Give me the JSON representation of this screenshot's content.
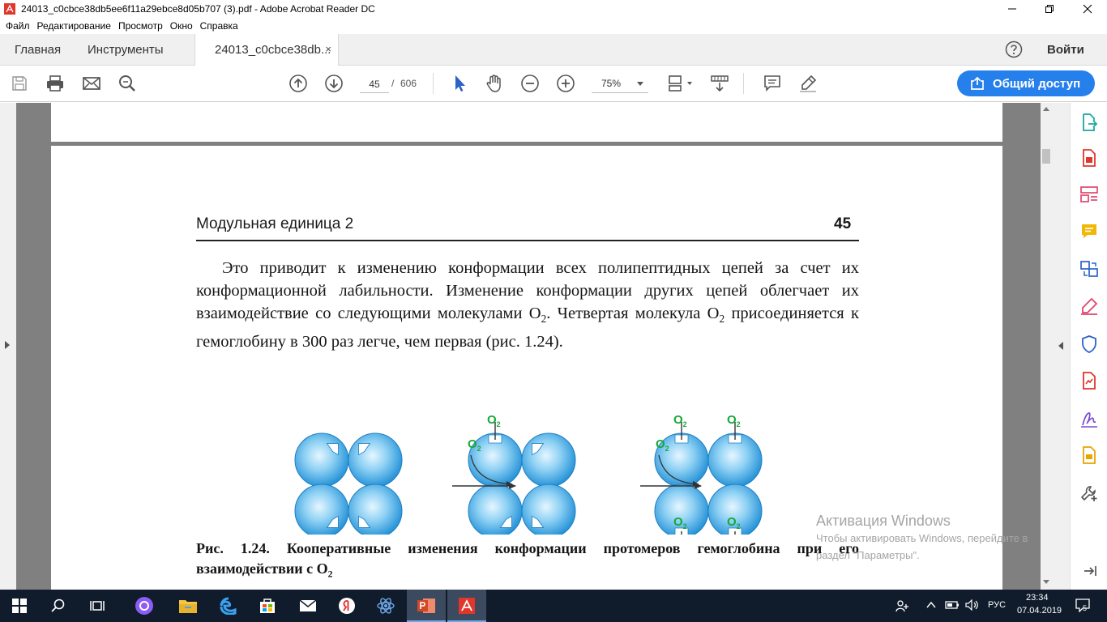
{
  "window": {
    "title": "24013_c0cbce38db5ee6f11a29ebce8d05b707 (3).pdf - Adobe Acrobat Reader DC"
  },
  "menu": [
    "Файл",
    "Редактирование",
    "Просмотр",
    "Окно",
    "Справка"
  ],
  "tabs": {
    "home": "Главная",
    "tools": "Инструменты",
    "document": "24013_c0cbce38db...",
    "close_glyph": "×"
  },
  "header": {
    "signin": "Войти"
  },
  "toolbar": {
    "page_current": "45",
    "page_separator": "/",
    "page_total": "606",
    "zoom": "75%",
    "share_label": "Общий доступ"
  },
  "page": {
    "header_left": "Модульная единица 2",
    "header_page_number": "45",
    "para": {
      "p1": "Это приводит к изменению конформации всех полипептидных цепей за счет их конформационной лабильности. Изменение конформации других цепей облегчает их взаимодействие со следующими молекулами O",
      "sub1": "2",
      "p2": ". Четвертая молекула O",
      "sub2": "2",
      "p3": " присоединяется к гемоглобину в 300 раз легче, чем первая (рис. 1.24)."
    },
    "figure": {
      "o2_label": "O",
      "o2_sub": "2"
    },
    "caption": {
      "c1": "Рис. 1.24. Кооперативные изменения конформации протомеров гемоглобина при его взаимодействии с O",
      "c_sub": "2"
    }
  },
  "watermark": {
    "title": "Активация Windows",
    "line1": "Чтобы активировать Windows, перейдите в",
    "line2": "раздел \"Параметры\"."
  },
  "taskbar": {
    "language": "РУС",
    "time": "23:34",
    "date": "07.04.2019",
    "notification_count": "5"
  },
  "colors": {
    "accent": "#2680eb",
    "acrobat_red": "#e0362c",
    "taskbar": "#101c2c",
    "o2_green": "#19a838",
    "globule_blue": "#3fa9e4"
  }
}
